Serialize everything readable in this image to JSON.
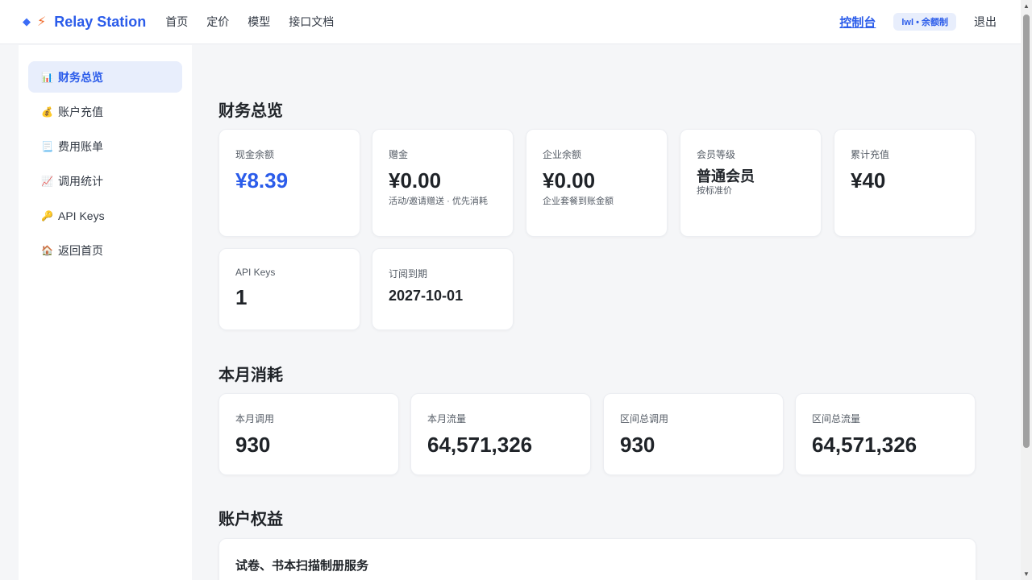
{
  "brand": {
    "name": "Relay Station",
    "diamond_icon": "diamond-icon",
    "bolt_icon": "lightning-icon"
  },
  "nav": [
    "首页",
    "定价",
    "模型",
    "接口文档"
  ],
  "header_right": {
    "console": "控制台",
    "badge": "lwl • 余额制",
    "logout": "退出"
  },
  "sidebar": {
    "items": [
      {
        "icon": "📊",
        "label": "财务总览",
        "active": true
      },
      {
        "icon": "💰",
        "label": "账户充值"
      },
      {
        "icon": "📃",
        "label": "费用账单"
      },
      {
        "icon": "📈",
        "label": "调用统计"
      },
      {
        "icon": "🔑",
        "label": "API Keys"
      },
      {
        "icon": "🏠",
        "label": "返回首页"
      }
    ]
  },
  "overview": {
    "title": "财务总览",
    "cash": {
      "label": "现金余额",
      "value": "¥8.39"
    },
    "bonus": {
      "label": "赠金",
      "value": "¥0.00",
      "sub": "活动/邀请赠送 · 优先消耗"
    },
    "enterprise": {
      "label": "企业余额",
      "value": "¥0.00",
      "sub": "企业套餐到账金额"
    },
    "member": {
      "label": "会员等级",
      "value": "普通会员",
      "sub": "按标准价"
    },
    "total_recharge": {
      "label": "累计充值",
      "value": "¥40"
    },
    "api_keys": {
      "label": "API Keys",
      "value": "1"
    },
    "subscription": {
      "label": "订阅到期",
      "value": "2027-10-01"
    }
  },
  "monthly": {
    "title": "本月消耗",
    "calls": {
      "label": "本月调用",
      "value": "930"
    },
    "traffic": {
      "label": "本月流量",
      "value": "64,571,326"
    },
    "range_calls": {
      "label": "区间总调用",
      "value": "930"
    },
    "range_traffic": {
      "label": "区间总流量",
      "value": "64,571,326"
    }
  },
  "rights": {
    "title": "账户权益",
    "item": "试卷、书本扫描制册服务"
  },
  "colors": {
    "accent": "#2b5cea",
    "background": "#f5f6f8",
    "card": "#ffffff"
  }
}
